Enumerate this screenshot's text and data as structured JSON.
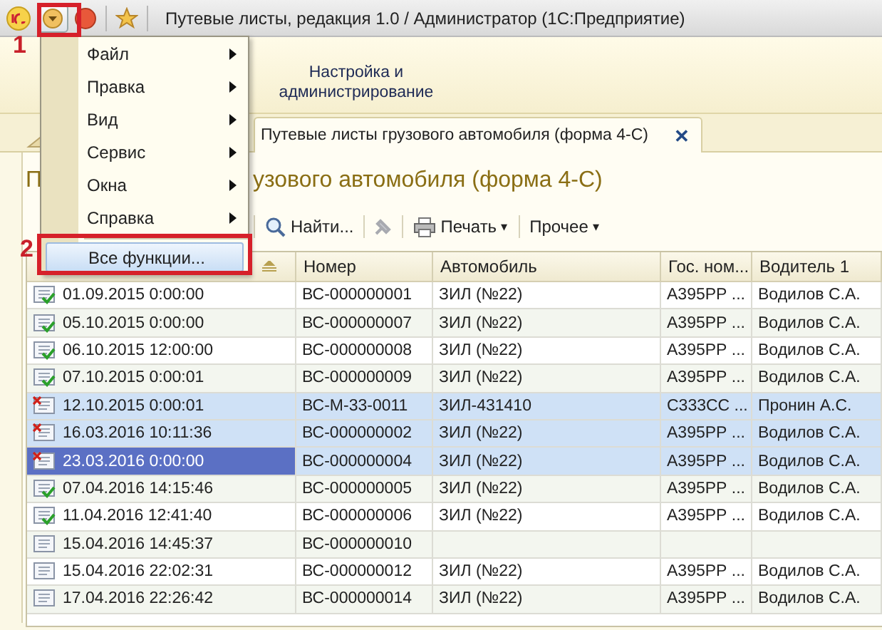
{
  "window": {
    "title": "Путевые листы, редакция 1.0 / Администратор  (1С:Предприятие)"
  },
  "sections": [
    {
      "label": "Настройка и администрирование",
      "selected": false
    }
  ],
  "tabs": [
    {
      "label": "Путевые листы грузового автомобиля (форма 4-С)",
      "selected": true,
      "close": "✕"
    }
  ],
  "form_title": {
    "start": "П",
    "end": "узового автомобиля (форма 4-С)"
  },
  "toolbar": [
    {
      "kind": "find",
      "label": "Найти..."
    },
    {
      "kind": "disabled"
    },
    {
      "kind": "print",
      "label": "Печать",
      "caret": "▾"
    },
    {
      "kind": "more",
      "label": "Прочее",
      "caret": "▾"
    }
  ],
  "table": {
    "columns": [
      "Номер",
      "Автомобиль",
      "Гос. ном...",
      "Водитель 1"
    ],
    "rows": [
      {
        "kind": "posted",
        "date": "01.09.2015 0:00:00",
        "number": "ВС-000000001",
        "car": "ЗИЛ (№22)",
        "plate": "А395РР ...",
        "driver": "Водилов С.А.",
        "selected": false,
        "current": false
      },
      {
        "kind": "posted",
        "date": "05.10.2015 0:00:00",
        "number": "ВС-000000007",
        "car": "ЗИЛ (№22)",
        "plate": "А395РР ...",
        "driver": "Водилов С.А.",
        "selected": false,
        "current": false
      },
      {
        "kind": "posted",
        "date": "06.10.2015 12:00:00",
        "number": "ВС-000000008",
        "car": "ЗИЛ (№22)",
        "plate": "А395РР ...",
        "driver": "Водилов С.А.",
        "selected": false,
        "current": false
      },
      {
        "kind": "posted",
        "date": "07.10.2015 0:00:01",
        "number": "ВС-000000009",
        "car": "ЗИЛ (№22)",
        "plate": "А395РР ...",
        "driver": "Водилов С.А.",
        "selected": false,
        "current": false
      },
      {
        "kind": "deleted",
        "date": "12.10.2015 0:00:01",
        "number": "ВС-М-33-0011",
        "car": "ЗИЛ-431410",
        "plate": "С333СС ...",
        "driver": "Пронин А.С.",
        "selected": true,
        "current": false
      },
      {
        "kind": "deleted",
        "date": "16.03.2016 10:11:36",
        "number": "ВС-000000002",
        "car": "ЗИЛ (№22)",
        "plate": "А395РР ...",
        "driver": "Водилов С.А.",
        "selected": true,
        "current": false
      },
      {
        "kind": "deleted",
        "date": "23.03.2016 0:00:00",
        "number": "ВС-000000004",
        "car": "ЗИЛ (№22)",
        "plate": "А395РР ...",
        "driver": "Водилов С.А.",
        "selected": true,
        "current": true
      },
      {
        "kind": "posted",
        "date": "07.04.2016 14:15:46",
        "number": "ВС-000000005",
        "car": "ЗИЛ (№22)",
        "plate": "А395РР ...",
        "driver": "Водилов С.А.",
        "selected": false,
        "current": false
      },
      {
        "kind": "posted",
        "date": "11.04.2016 12:41:40",
        "number": "ВС-000000006",
        "car": "ЗИЛ (№22)",
        "plate": "А395РР ...",
        "driver": "Водилов С.А.",
        "selected": false,
        "current": false
      },
      {
        "kind": "plain",
        "date": "15.04.2016 14:45:37",
        "number": "ВС-000000010",
        "selected": false,
        "current": false
      },
      {
        "kind": "plain",
        "date": "15.04.2016 22:02:31",
        "number": "ВС-000000012",
        "car": "ЗИЛ (№22)",
        "plate": "А395РР ...",
        "driver": "Водилов С.А.",
        "selected": false,
        "current": false
      },
      {
        "kind": "plain",
        "date": "17.04.2016 22:26:42",
        "number": "ВС-000000014",
        "car": "ЗИЛ (№22)",
        "plate": "А395РР ...",
        "driver": "Водилов С.А.",
        "selected": false,
        "current": false
      }
    ]
  },
  "menu": {
    "items": [
      {
        "label": "Файл",
        "submenu": true,
        "highlighted": false
      },
      {
        "label": "Правка",
        "submenu": true,
        "highlighted": false
      },
      {
        "label": "Вид",
        "submenu": true,
        "highlighted": false
      },
      {
        "label": "Сервис",
        "submenu": true,
        "highlighted": false
      },
      {
        "label": "Окна",
        "submenu": true,
        "highlighted": false
      },
      {
        "label": "Справка",
        "submenu": true,
        "highlighted": false
      },
      {
        "label": "Все функции...",
        "submenu": false,
        "highlighted": true
      }
    ]
  },
  "annotations": [
    {
      "label": "1"
    },
    {
      "label": "2"
    }
  ]
}
